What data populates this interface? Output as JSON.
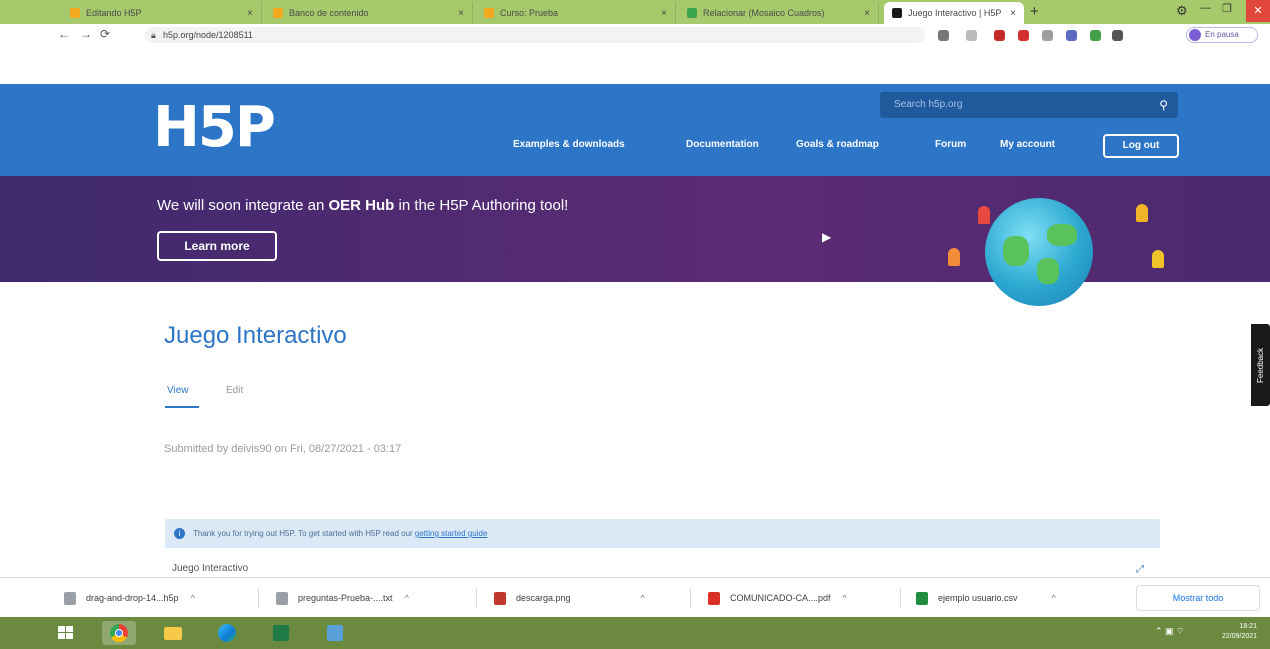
{
  "browser": {
    "tabs": [
      {
        "title": "Editando H5P",
        "favicon_color": "#f2a91f"
      },
      {
        "title": "Banco de contenido",
        "favicon_color": "#f2a91f"
      },
      {
        "title": "Curso: Prueba",
        "favicon_color": "#f2a91f"
      },
      {
        "title": "Relacionar (Mosaico Cuadros)",
        "favicon_color": "#3aa64b"
      },
      {
        "title": "Juego Interactivo | H5P",
        "favicon_color": "#1b1b1b",
        "active": true
      }
    ],
    "new_tab_label": "+",
    "url": "h5p.org/node/1208511",
    "profile_label": "En pausa"
  },
  "header": {
    "logo": "H5P",
    "search_placeholder": "Search h5p.org",
    "nav": [
      "Examples & downloads",
      "Documentation",
      "Goals & roadmap",
      "Forum",
      "My account"
    ],
    "logout_label": "Log out"
  },
  "banner": {
    "text_before": "We will soon integrate an ",
    "text_bold": "OER Hub",
    "text_after": " in the H5P Authoring tool!",
    "button_label": "Learn more"
  },
  "content": {
    "title": "Juego Interactivo",
    "tab_view": "View",
    "tab_edit": "Edit",
    "submitted": "Submitted by deivis90 on Fri, 08/27/2021 - 03:17",
    "notice_text": "Thank you for trying out H5P. To get started with H5P read our ",
    "notice_link": "getting started guide",
    "h5p_title": "Juego Interactivo",
    "feedback_label": "Feedback"
  },
  "downloads": {
    "items": [
      {
        "name": "drag-and-drop-14...h5p",
        "icon_color": "#9aa0a6"
      },
      {
        "name": "preguntas-Prueba-....txt",
        "icon_color": "#9aa0a6"
      },
      {
        "name": "descarga.png",
        "icon_color": "#c0392b"
      },
      {
        "name": "COMUNICADO-CA....pdf",
        "icon_color": "#d93025"
      },
      {
        "name": "ejemplo usuario.csv",
        "icon_color": "#1e8e3e"
      }
    ],
    "show_all_label": "Mostrar todo"
  },
  "taskbar": {
    "time": "18:21",
    "date": "22/09/2021"
  }
}
